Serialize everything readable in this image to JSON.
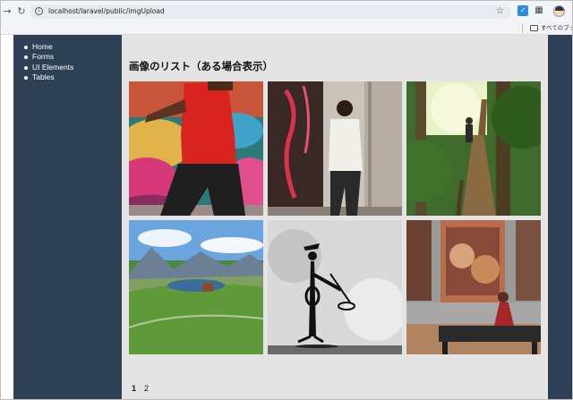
{
  "browser": {
    "url": "localhost/laravel/public/imgUpload",
    "bookmarks_label": "すべてのブックマ"
  },
  "sidebar": {
    "items": [
      {
        "label": "Home"
      },
      {
        "label": "Forms"
      },
      {
        "label": "UI Elements"
      },
      {
        "label": "Tables"
      }
    ]
  },
  "main": {
    "title": "画像のリスト（ある場合表示）",
    "images": [
      {
        "subject": "graffiti-wall-person"
      },
      {
        "subject": "man-in-doorway"
      },
      {
        "subject": "jungle-boardwalk"
      },
      {
        "subject": "mountain-lake"
      },
      {
        "subject": "trumpet-figure"
      },
      {
        "subject": "museum-painting-viewer"
      }
    ]
  },
  "pagination": {
    "pages": [
      "1",
      "2"
    ],
    "current": "1"
  },
  "colors": {
    "sidebar_bg": "#2d4056",
    "content_bg": "#e4e4e4"
  }
}
